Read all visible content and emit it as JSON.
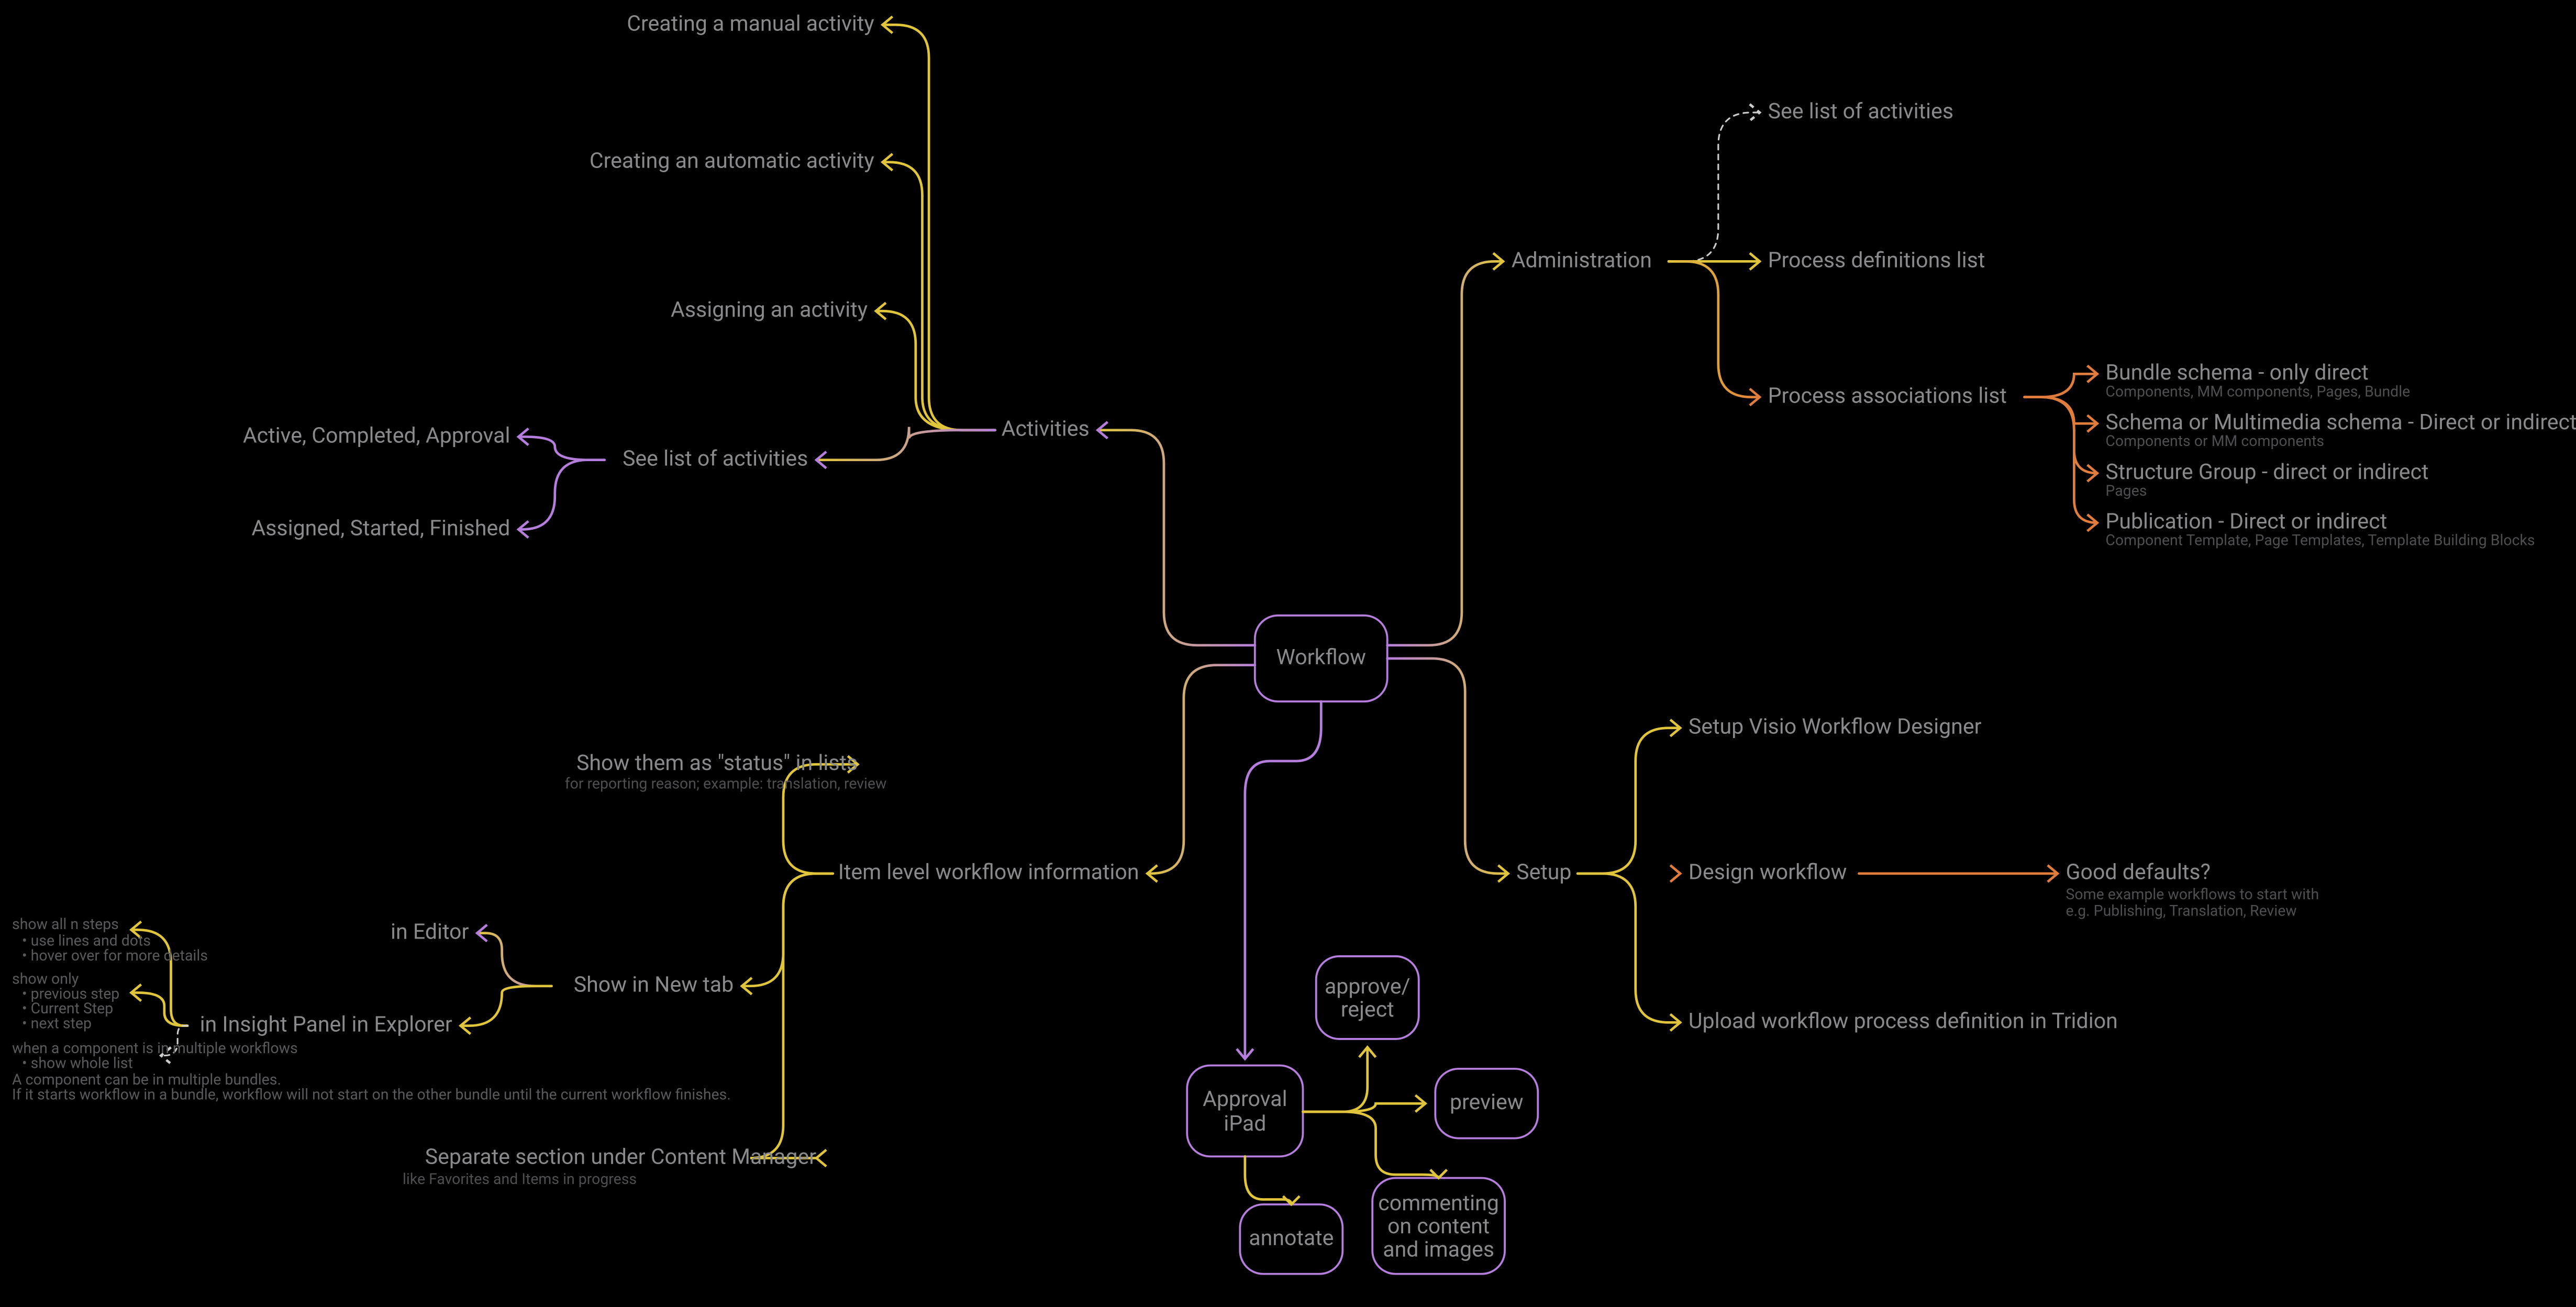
{
  "root": {
    "label": "Workflow"
  },
  "branches": {
    "activities": {
      "label": "Activities",
      "children": {
        "create_manual": "Creating a manual activity",
        "create_auto": "Creating an automatic activity",
        "assign": "Assigning an activity",
        "see_list": {
          "label": "See list of activities",
          "children": {
            "ac_comp_app": "Active, Completed, Approval",
            "ass_st_fin": "Assigned, Started, Finished"
          }
        }
      }
    },
    "admin": {
      "label": "Administration",
      "children": {
        "see_list": "See list of activities",
        "definitions": "Process definitions list",
        "associations": {
          "label": "Process associations list",
          "children": {
            "bundle": {
              "title": "Bundle schema - only direct",
              "sub": "Components, MM components, Pages, Bundle"
            },
            "schema": {
              "title": "Schema or Multimedia schema - Direct or indirect",
              "sub": "Components or MM components"
            },
            "sg": {
              "title": "Structure Group - direct or indirect",
              "sub": "Pages"
            },
            "pub": {
              "title": "Publication - Direct or indirect",
              "sub": "Component Template, Page Templates, Template Building Blocks"
            }
          }
        }
      }
    },
    "setup": {
      "label": "Setup",
      "children": {
        "visio": "Setup Visio Workflow Designer",
        "design": {
          "label": "Design workflow",
          "children": {
            "defaults": {
              "title": "Good defaults?",
              "sub": "Some example workflows to start with e.g. Publishing, Translation, Review"
            }
          }
        },
        "upload": "Upload workflow process definition in Tridion"
      }
    },
    "item_level": {
      "label": "Item level workflow information",
      "children": {
        "status": {
          "title": "Show them as \"status\" in lists",
          "sub": "for reporting reason; example: translation, review"
        },
        "newtab": {
          "label": "Show in New tab",
          "children": {
            "editor": "in Editor",
            "explorer": "in Insight Panel in Explorer"
          }
        },
        "separate": {
          "title": "Separate section under Content Manager",
          "sub": "like Favorites and Items in progress"
        }
      }
    },
    "approval": {
      "label": "Approval iPad",
      "children": {
        "approve": "approve/reject",
        "preview": "preview",
        "annotate": "annotate",
        "comment": "commenting on content and images"
      }
    }
  },
  "notes": {
    "show_all": {
      "title": "show all n steps",
      "bullets": [
        "use lines and dots",
        "hover over for more details"
      ]
    },
    "show_only": {
      "title": "show only",
      "bullets": [
        "previous step",
        "Current Step",
        "next step"
      ]
    },
    "multiple_wf": {
      "title": "when a component is in multiple workflows",
      "bullets": [
        "show whole list"
      ],
      "extra1": "A component can be in multiple bundles.",
      "extra2": "If it starts workflow in a bundle, workflow will not start on the other bundle until the current workflow finishes."
    }
  }
}
